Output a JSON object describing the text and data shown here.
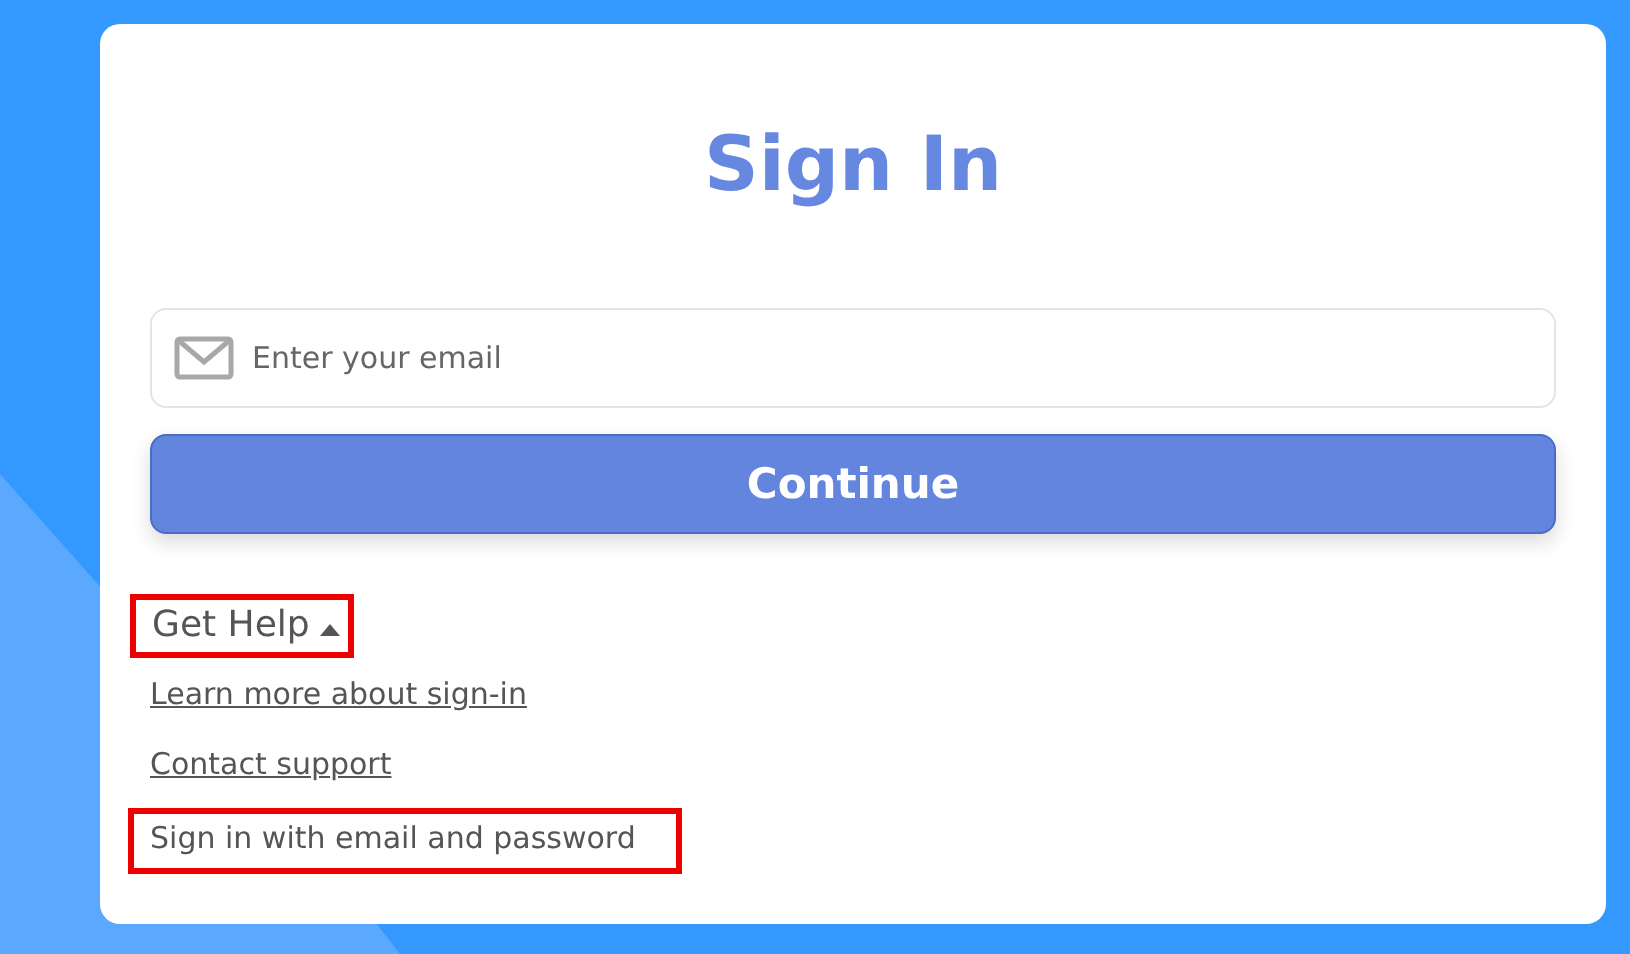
{
  "title": "Sign In",
  "email_field": {
    "placeholder": "Enter your email"
  },
  "continue_button": {
    "label": "Continue"
  },
  "help": {
    "label": "Get Help",
    "expanded": true,
    "highlighted": true,
    "links": [
      {
        "label": "Learn more about sign-in",
        "kind": "link",
        "highlighted": false
      },
      {
        "label": "Contact support",
        "kind": "link",
        "highlighted": false
      },
      {
        "label": "Sign in with email and password",
        "kind": "option",
        "highlighted": true
      }
    ]
  }
}
